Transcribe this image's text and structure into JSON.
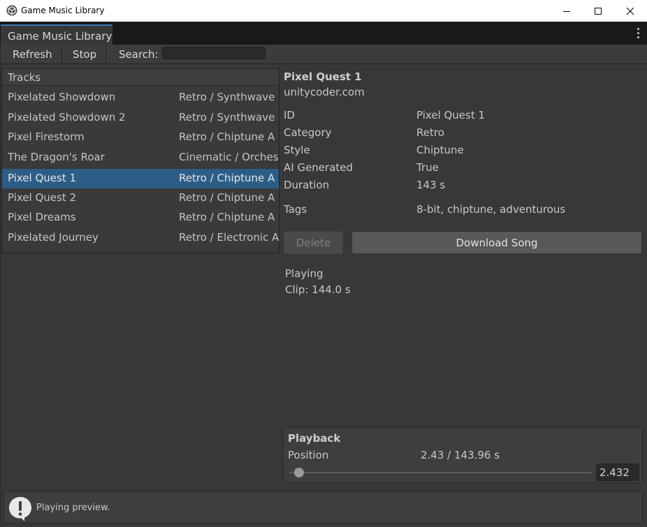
{
  "window": {
    "title": "Game Music Library",
    "icon": "unity-logo-icon",
    "controls": [
      "minimize-icon",
      "maximize-icon",
      "close-icon"
    ]
  },
  "tab": {
    "label": "Game Music Library"
  },
  "toolbar": {
    "refresh_label": "Refresh",
    "stop_label": "Stop",
    "search_label": "Search:",
    "search_value": ""
  },
  "tracks": {
    "header": "Tracks",
    "items": [
      {
        "name": "Pixelated Showdown",
        "category": "Retro / Synthwave"
      },
      {
        "name": "Pixelated Showdown 2",
        "category": "Retro / Synthwave"
      },
      {
        "name": "Pixel Firestorm",
        "category": "Retro / Chiptune  A"
      },
      {
        "name": "The Dragon's Roar",
        "category": "Cinematic / Orches"
      },
      {
        "name": "Pixel Quest 1",
        "category": "Retro / Chiptune  A"
      },
      {
        "name": "Pixel Quest 2",
        "category": "Retro / Chiptune  A"
      },
      {
        "name": "Pixel Dreams",
        "category": "Retro / Chiptune  A"
      },
      {
        "name": "Pixelated Journey",
        "category": "Retro / Electronic  A"
      }
    ],
    "selected_index": 4
  },
  "details": {
    "title": "Pixel Quest 1",
    "subtitle": "unitycoder.com",
    "fields": [
      {
        "label": "ID",
        "value": "Pixel Quest 1"
      },
      {
        "label": "Category",
        "value": "Retro"
      },
      {
        "label": "Style",
        "value": "Chiptune"
      },
      {
        "label": "AI Generated",
        "value": "True"
      },
      {
        "label": "Duration",
        "value": "143 s"
      },
      {
        "label": "Tags",
        "value": "8-bit, chiptune, adventurous"
      }
    ],
    "delete_label": "Delete",
    "download_label": "Download Song",
    "status": "Playing",
    "clip": "Clip: 144.0 s"
  },
  "playback": {
    "title": "Playback",
    "position_label": "Position",
    "position_readout": "2.43 / 143.96 s",
    "position_value": "2.432",
    "position_fraction": 0.0169
  },
  "statusbar": {
    "icon": "info-exclamation-icon",
    "message": "Playing preview."
  },
  "colors": {
    "selection": "#2c5d87",
    "tab_accent": "#3a79bb",
    "background": "#383838"
  }
}
